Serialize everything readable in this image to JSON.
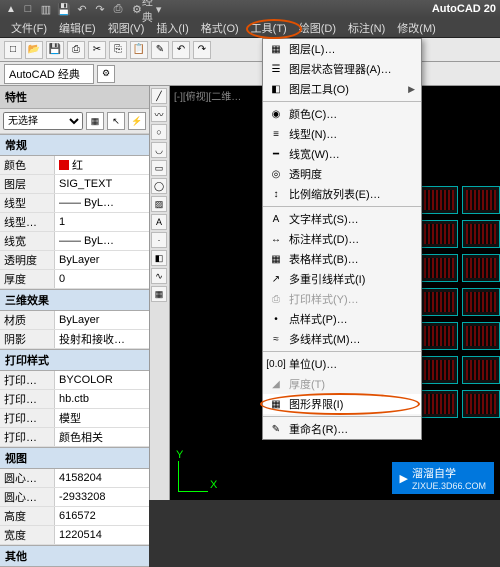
{
  "app": {
    "name": "AutoCAD 20",
    "ws_badge": "经典"
  },
  "qat": [
    "新",
    "开",
    "保",
    "撤",
    "重",
    "打"
  ],
  "menu": {
    "file": "文件(F)",
    "edit": "编辑(E)",
    "view": "视图(V)",
    "insert": "插入(I)",
    "format": "格式(O)",
    "tools": "工具(T)",
    "draw": "绘图(D)",
    "dim": "标注(N)",
    "modify": "修改(M)"
  },
  "workspace": "AutoCAD 经典",
  "props": {
    "title": "特性",
    "selector": "无选择",
    "groups": {
      "g1": "常规",
      "g1_rows": [
        {
          "l": "颜色",
          "v": "红",
          "c": "#d00"
        },
        {
          "l": "图层",
          "v": "SIG_TEXT"
        },
        {
          "l": "线型",
          "v": "—— ByL…"
        },
        {
          "l": "线型…",
          "v": "1"
        },
        {
          "l": "线宽",
          "v": "—— ByL…"
        },
        {
          "l": "透明度",
          "v": "ByLayer"
        },
        {
          "l": "厚度",
          "v": "0"
        }
      ],
      "g2": "三维效果",
      "g2_rows": [
        {
          "l": "材质",
          "v": "ByLayer"
        },
        {
          "l": "阴影",
          "v": "投射和接收…"
        }
      ],
      "g3": "打印样式",
      "g3_rows": [
        {
          "l": "打印…",
          "v": "BYCOLOR"
        },
        {
          "l": "打印…",
          "v": "hb.ctb"
        },
        {
          "l": "打印…",
          "v": "模型"
        },
        {
          "l": "打印…",
          "v": "颜色相关"
        }
      ],
      "g4": "视图",
      "g4_rows": [
        {
          "l": "圆心…",
          "v": "4158204"
        },
        {
          "l": "圆心…",
          "v": "-2933208"
        },
        {
          "l": "高度",
          "v": "616572"
        },
        {
          "l": "宽度",
          "v": "1220514"
        }
      ],
      "g5": "其他"
    }
  },
  "dropdown": {
    "items": [
      {
        "icon": "▦",
        "label": "图层(L)…",
        "arr": false
      },
      {
        "icon": "☰",
        "label": "图层状态管理器(A)…",
        "arr": false
      },
      {
        "icon": "◧",
        "label": "图层工具(O)",
        "arr": true
      },
      {
        "sep": true
      },
      {
        "icon": "◉",
        "label": "颜色(C)…",
        "arr": false
      },
      {
        "icon": "≡",
        "label": "线型(N)…",
        "arr": false
      },
      {
        "icon": "━",
        "label": "线宽(W)…",
        "arr": false
      },
      {
        "icon": "◎",
        "label": "透明度",
        "arr": false
      },
      {
        "icon": "↕",
        "label": "比例缩放列表(E)…",
        "arr": false
      },
      {
        "sep": true
      },
      {
        "icon": "A",
        "label": "文字样式(S)…",
        "arr": false
      },
      {
        "icon": "↔",
        "label": "标注样式(D)…",
        "arr": false
      },
      {
        "icon": "▦",
        "label": "表格样式(B)…",
        "arr": false
      },
      {
        "icon": "↗",
        "label": "多重引线样式(I)",
        "arr": false
      },
      {
        "icon": "⎙",
        "label": "打印样式(Y)…",
        "arr": false,
        "disabled": true
      },
      {
        "icon": "•",
        "label": "点样式(P)…",
        "arr": false
      },
      {
        "icon": "≈",
        "label": "多线样式(M)…",
        "arr": false
      },
      {
        "sep": true
      },
      {
        "icon": "[0.0]",
        "label": "单位(U)…",
        "arr": false
      },
      {
        "icon": "◢",
        "label": "厚度(T)",
        "arr": false,
        "disabled": true
      },
      {
        "icon": "▦",
        "label": "图形界限(I)",
        "arr": false,
        "hl": true
      },
      {
        "sep": true
      },
      {
        "icon": "✎",
        "label": "重命名(R)…",
        "arr": false
      }
    ]
  },
  "canvas": {
    "viewtab": "[-][俯视][二维…"
  },
  "watermark": {
    "main": "溜溜自学",
    "sub": "ZIXUE.3D66.COM"
  }
}
